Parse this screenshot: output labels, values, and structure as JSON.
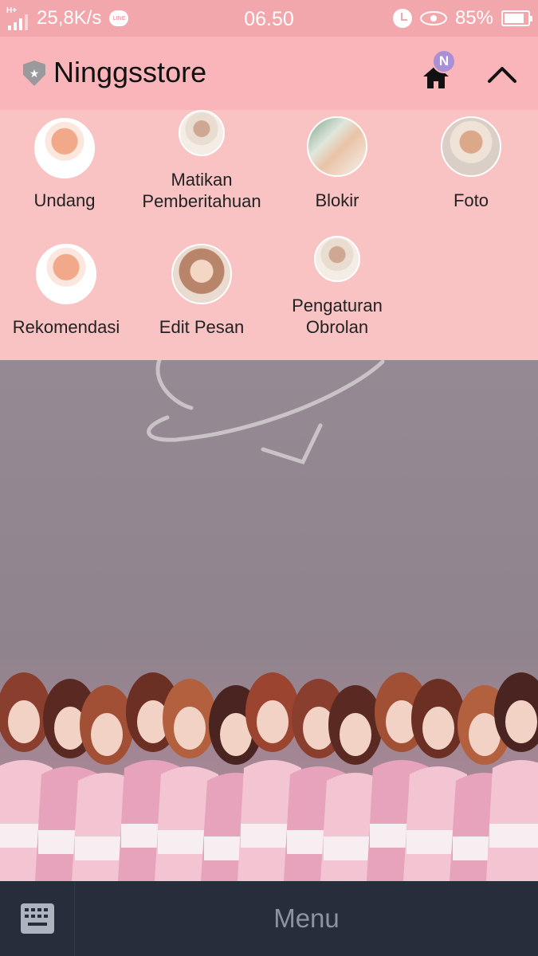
{
  "status_bar": {
    "network_type": "H+",
    "speed": "25,8K/s",
    "line_badge": "LINE",
    "time": "06.50",
    "battery_percent": "85%",
    "battery_level": 0.85
  },
  "header": {
    "title": "Ninggsstore",
    "home_badge": "N"
  },
  "menu": {
    "items": [
      {
        "label": "Undang"
      },
      {
        "label": "Matikan\nPemberitahuan"
      },
      {
        "label": "Blokir"
      },
      {
        "label": "Foto"
      },
      {
        "label": "Rekomendasi"
      },
      {
        "label": "Edit Pesan"
      },
      {
        "label": "Pengaturan\nObrolan"
      }
    ]
  },
  "bottom_bar": {
    "menu_label": "Menu"
  },
  "colors": {
    "status_bar": "#f2a7ad",
    "header": "#f9b5b9",
    "menu_panel": "#f9c3c4",
    "bottom_bar": "#272d3b",
    "badge": "#a98fd4"
  }
}
